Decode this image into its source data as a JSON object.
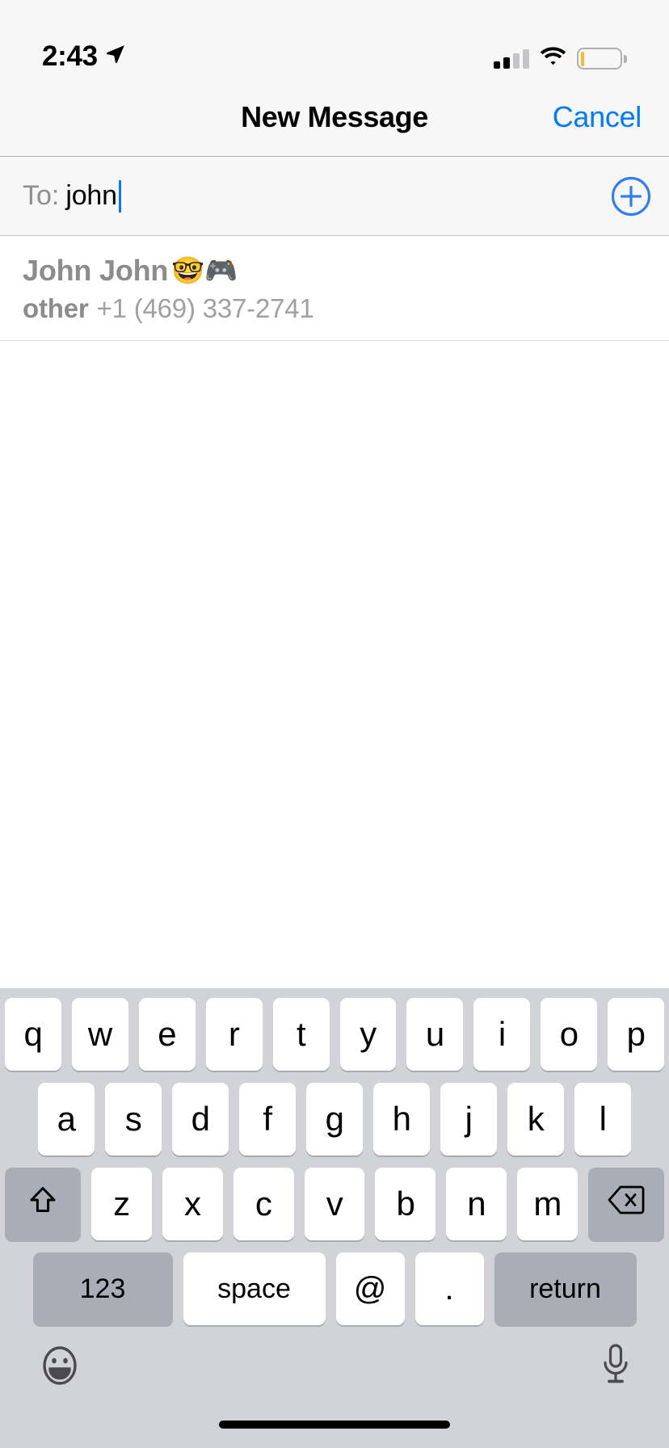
{
  "status_bar": {
    "time": "2:43",
    "location_icon": "location-arrow-icon",
    "cellular_icon": "cellular-signal-icon",
    "cellular_bars_filled": 2,
    "cellular_bars_total": 4,
    "wifi_icon": "wifi-icon",
    "battery_icon": "battery-icon",
    "battery_percent_visual": 9,
    "battery_color": "#f5bc2e"
  },
  "nav_bar": {
    "title": "New Message",
    "cancel_label": "Cancel",
    "cancel_color": "#007aff"
  },
  "to_field": {
    "label": "To:",
    "value": "john",
    "placeholder": "",
    "add_contact_icon": "plus-circle-icon",
    "accent_color": "#007aff"
  },
  "suggestions": [
    {
      "name": "John John",
      "emoji": "🤓🎮",
      "label": "other",
      "detail": "+1 (469) 337-2741"
    }
  ],
  "keyboard": {
    "row1": [
      "q",
      "w",
      "e",
      "r",
      "t",
      "y",
      "u",
      "i",
      "o",
      "p"
    ],
    "row2": [
      "a",
      "s",
      "d",
      "f",
      "g",
      "h",
      "j",
      "k",
      "l"
    ],
    "row3": [
      "z",
      "x",
      "c",
      "v",
      "b",
      "n",
      "m"
    ],
    "shift_icon": "shift-arrow-icon",
    "delete_icon": "delete-backspace-icon",
    "numeric_label": "123",
    "space_label": "space",
    "at_label": "@",
    "dot_label": ".",
    "return_label": "return",
    "emoji_icon": "emoji-smiley-icon",
    "dictation_icon": "microphone-icon",
    "key_bg": "#ffffff",
    "modifier_bg": "#a9adb6",
    "keyboard_bg": "#d1d3d9"
  }
}
